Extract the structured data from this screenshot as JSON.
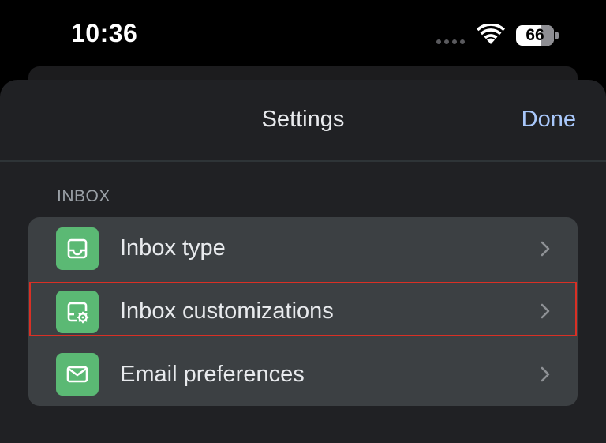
{
  "status_bar": {
    "time": "10:36",
    "battery_level": "66",
    "icons": [
      "cellular-dots-icon",
      "wifi-icon",
      "battery-icon"
    ]
  },
  "sheet": {
    "title": "Settings",
    "done_label": "Done"
  },
  "inbox_section": {
    "label": "INBOX",
    "items": [
      {
        "label": "Inbox type",
        "icon": "inbox-tray-icon"
      },
      {
        "label": "Inbox customizations",
        "icon": "inbox-settings-icon",
        "highlighted": true
      },
      {
        "label": "Email preferences",
        "icon": "envelope-icon"
      }
    ]
  },
  "colors": {
    "background": "#000000",
    "sheet": "#202124",
    "group": "#3c4043",
    "icon_tile": "#5bb974",
    "accent_done": "#a8c7fa",
    "highlight_border": "#d93025",
    "text_primary": "#e8eaed",
    "text_secondary": "#9aa0a6"
  }
}
